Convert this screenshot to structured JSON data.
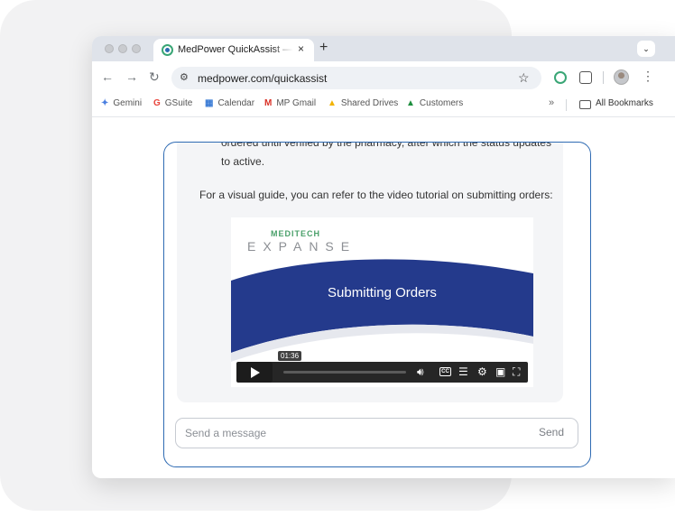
{
  "browser": {
    "tab": {
      "title": "MedPower QuickAssist — Me",
      "close": "×"
    },
    "new_tab": "+",
    "tab_menu": "⌄",
    "nav": {
      "back": "←",
      "forward": "→",
      "reload": "↻"
    },
    "url": "medpower.com/quickassist",
    "star": "☆",
    "menu": "⋮"
  },
  "bookmarks": {
    "items": [
      {
        "icon": "✦",
        "label": "Gemini",
        "icon_color": "#4a7fe0"
      },
      {
        "icon": "G",
        "label": "GSuite",
        "icon_color": "#e8453c"
      },
      {
        "icon": "▦",
        "label": "Calendar",
        "icon_color": "#3a7bd5"
      },
      {
        "icon": "M",
        "label": "MP Gmail",
        "icon_color": "#d93025"
      },
      {
        "icon": "▲",
        "label": "Shared Drives",
        "icon_color": "#f2b300"
      },
      {
        "icon": "▲",
        "label": "Customers",
        "icon_color": "#1e8e3e"
      }
    ],
    "overflow": "»",
    "all_label": "All Bookmarks"
  },
  "chat": {
    "message": {
      "line1": "ordered until verified by the pharmacy, after which the status updates",
      "line2": "to active.",
      "line3": "For a visual guide, you can refer to the video tutorial on submitting orders:"
    },
    "video": {
      "brand": "MEDITECH",
      "product": "EXPANSE",
      "title": "Submitting Orders",
      "time": "01:36",
      "cc": "CC"
    },
    "composer": {
      "placeholder": "Send a message",
      "send_label": "Send"
    }
  },
  "colors": {
    "accent": "#2f6bb3",
    "video_band": "#243a8c",
    "brand_green": "#4aa06a"
  }
}
